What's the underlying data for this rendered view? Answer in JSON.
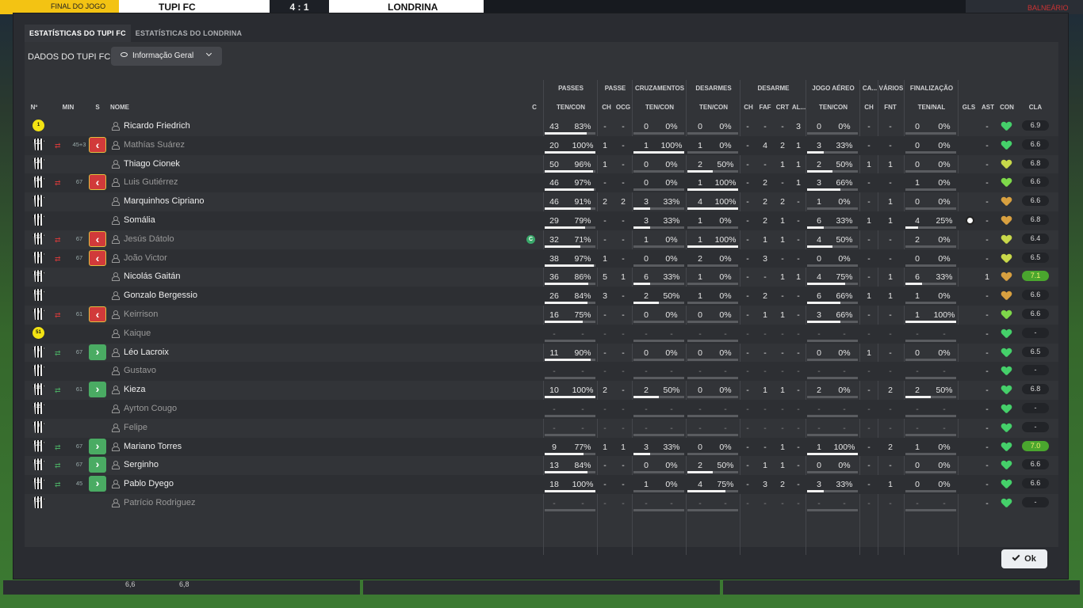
{
  "header": {
    "status": "FINAL DO JOGO",
    "home_team": "TUPI FC",
    "score": "4 : 1",
    "away_team": "LONDRINA",
    "right_label": "BALNEÁRIO"
  },
  "tabs": [
    {
      "label": "ESTATÍSTICAS DO TUPI FC",
      "active": true
    },
    {
      "label": "ESTATÍSTICAS DO LONDRINA",
      "active": false
    }
  ],
  "panel": {
    "title": "DADOS DO TUPI FC",
    "view_select": "Informação Geral"
  },
  "column_groups": [
    "PASSES",
    "PASSE",
    "CRUZAMENTOS",
    "DESARMES",
    "DESARME",
    "JOGO AÉREO",
    "CA...",
    "VÁRIOS",
    "FINALIZAÇÃO"
  ],
  "columns": {
    "num": "Nº",
    "min": "MIN",
    "s": "S",
    "name": "NOME",
    "c": "C",
    "passes": "TEN/CON",
    "ch": "CH",
    "ocg": "OCG",
    "cross": "TEN/CON",
    "tack": "TEN/CON",
    "d_ch": "CH",
    "faf": "FAF",
    "crt": "CRT",
    "al": "AL...",
    "aerial": "TEN/CON",
    "ca_ch": "CH",
    "fnt": "FNT",
    "shots": "TEN/NAL",
    "gls": "GLS",
    "ast": "AST",
    "con": "CON",
    "cla": "CLA"
  },
  "players": [
    {
      "n": "1",
      "gk": true,
      "min": "",
      "sub": "",
      "name": "Ricardo Friedrich",
      "dim": false,
      "cap": false,
      "pt": "43",
      "pc": "83%",
      "pp": 0.83,
      "ch": "-",
      "ocg": "-",
      "xt": "0",
      "xp": "0%",
      "xpp": 0,
      "dt": "0",
      "dp": "0%",
      "dpp": 0,
      "dch": "-",
      "faf": "-",
      "crt": "-",
      "al": "3",
      "at": "0",
      "ap": "0%",
      "app": 0,
      "cach": "-",
      "fnt": "-",
      "st": "0",
      "sp": "0%",
      "spp": 0,
      "gls": "",
      "ast": "-",
      "con": "#45d06a",
      "cla": "6.9",
      "best": false
    },
    {
      "n": "22",
      "gk": false,
      "min": "45+3",
      "sub": "out",
      "name": "Mathías Suárez",
      "dim": true,
      "cap": false,
      "pt": "20",
      "pc": "100%",
      "pp": 1,
      "ch": "1",
      "ocg": "-",
      "xt": "1",
      "xp": "100%",
      "xpp": 1,
      "dt": "1",
      "dp": "0%",
      "dpp": 0,
      "dch": "-",
      "faf": "4",
      "crt": "2",
      "al": "1",
      "at": "3",
      "ap": "33%",
      "app": 0.33,
      "cach": "-",
      "fnt": "-",
      "st": "0",
      "sp": "0%",
      "spp": 0,
      "gls": "",
      "ast": "-",
      "con": "#45d06a",
      "cla": "6.6",
      "best": false
    },
    {
      "n": "26",
      "gk": false,
      "min": "",
      "sub": "",
      "name": "Thiago Cionek",
      "dim": false,
      "cap": false,
      "pt": "50",
      "pc": "96%",
      "pp": 0.96,
      "ch": "1",
      "ocg": "-",
      "xt": "0",
      "xp": "0%",
      "xpp": 0,
      "dt": "2",
      "dp": "50%",
      "dpp": 0.5,
      "dch": "-",
      "faf": "-",
      "crt": "1",
      "al": "1",
      "at": "2",
      "ap": "50%",
      "app": 0.5,
      "cach": "1",
      "fnt": "1",
      "st": "0",
      "sp": "0%",
      "spp": 0,
      "gls": "",
      "ast": "-",
      "con": "#c8d84a",
      "cla": "6.8",
      "best": false
    },
    {
      "n": "14",
      "gk": false,
      "min": "67",
      "sub": "out",
      "name": "Luis Gutiérrez",
      "dim": true,
      "cap": false,
      "pt": "46",
      "pc": "97%",
      "pp": 0.97,
      "ch": "-",
      "ocg": "-",
      "xt": "0",
      "xp": "0%",
      "xpp": 0,
      "dt": "1",
      "dp": "100%",
      "dpp": 1,
      "dch": "-",
      "faf": "2",
      "crt": "-",
      "al": "1",
      "at": "3",
      "ap": "66%",
      "app": 0.66,
      "cach": "-",
      "fnt": "-",
      "st": "1",
      "sp": "0%",
      "spp": 0,
      "gls": "",
      "ast": "-",
      "con": "#7ed84a",
      "cla": "6.6",
      "best": false
    },
    {
      "n": "6",
      "gk": false,
      "min": "",
      "sub": "",
      "name": "Marquinhos Cipriano",
      "dim": false,
      "cap": false,
      "pt": "46",
      "pc": "91%",
      "pp": 0.91,
      "ch": "2",
      "ocg": "2",
      "xt": "3",
      "xp": "33%",
      "xpp": 0.33,
      "dt": "4",
      "dp": "100%",
      "dpp": 1,
      "dch": "-",
      "faf": "2",
      "crt": "2",
      "al": "-",
      "at": "1",
      "ap": "0%",
      "app": 0,
      "cach": "-",
      "fnt": "1",
      "st": "0",
      "sp": "0%",
      "spp": 0,
      "gls": "",
      "ast": "-",
      "con": "#d8a040",
      "cla": "6.6",
      "best": false
    },
    {
      "n": "2",
      "gk": false,
      "min": "",
      "sub": "",
      "name": "Somália",
      "dim": false,
      "cap": false,
      "pt": "29",
      "pc": "79%",
      "pp": 0.79,
      "ch": "-",
      "ocg": "-",
      "xt": "3",
      "xp": "33%",
      "xpp": 0.33,
      "dt": "1",
      "dp": "0%",
      "dpp": 0,
      "dch": "-",
      "faf": "2",
      "crt": "1",
      "al": "-",
      "at": "6",
      "ap": "33%",
      "app": 0.33,
      "cach": "1",
      "fnt": "1",
      "st": "4",
      "sp": "25%",
      "spp": 0.25,
      "gls": "ball",
      "ast": "-",
      "con": "#d8a040",
      "cla": "6.8",
      "best": false
    },
    {
      "n": "12",
      "gk": false,
      "min": "67",
      "sub": "out",
      "name": "Jesús Dátolo",
      "dim": true,
      "cap": true,
      "pt": "32",
      "pc": "71%",
      "pp": 0.71,
      "ch": "-",
      "ocg": "-",
      "xt": "1",
      "xp": "0%",
      "xpp": 0,
      "dt": "1",
      "dp": "100%",
      "dpp": 1,
      "dch": "-",
      "faf": "1",
      "crt": "1",
      "al": "-",
      "at": "4",
      "ap": "50%",
      "app": 0.5,
      "cach": "-",
      "fnt": "-",
      "st": "2",
      "sp": "0%",
      "spp": 0,
      "gls": "",
      "ast": "-",
      "con": "#c8d84a",
      "cla": "6.4",
      "best": false
    },
    {
      "n": "3",
      "gk": false,
      "min": "67",
      "sub": "out",
      "name": "João Victor",
      "dim": true,
      "cap": false,
      "pt": "38",
      "pc": "97%",
      "pp": 0.97,
      "ch": "1",
      "ocg": "-",
      "xt": "0",
      "xp": "0%",
      "xpp": 0,
      "dt": "2",
      "dp": "0%",
      "dpp": 0,
      "dch": "-",
      "faf": "3",
      "crt": "-",
      "al": "-",
      "at": "0",
      "ap": "0%",
      "app": 0,
      "cach": "-",
      "fnt": "-",
      "st": "0",
      "sp": "0%",
      "spp": 0,
      "gls": "",
      "ast": "-",
      "con": "#c8d84a",
      "cla": "6.5",
      "best": false
    },
    {
      "n": "15",
      "gk": false,
      "min": "",
      "sub": "",
      "name": "Nicolás Gaitán",
      "dim": false,
      "cap": false,
      "pt": "36",
      "pc": "86%",
      "pp": 0.86,
      "ch": "5",
      "ocg": "1",
      "xt": "6",
      "xp": "33%",
      "xpp": 0.33,
      "dt": "1",
      "dp": "0%",
      "dpp": 0,
      "dch": "-",
      "faf": "-",
      "crt": "1",
      "al": "1",
      "at": "4",
      "ap": "75%",
      "app": 0.75,
      "cach": "-",
      "fnt": "1",
      "st": "6",
      "sp": "33%",
      "spp": 0.33,
      "gls": "",
      "ast": "1",
      "con": "#d8a040",
      "cla": "7.1",
      "best": true
    },
    {
      "n": "10",
      "gk": false,
      "min": "",
      "sub": "",
      "name": "Gonzalo Bergessio",
      "dim": false,
      "cap": false,
      "pt": "26",
      "pc": "84%",
      "pp": 0.84,
      "ch": "3",
      "ocg": "-",
      "xt": "2",
      "xp": "50%",
      "xpp": 0.5,
      "dt": "1",
      "dp": "0%",
      "dpp": 0,
      "dch": "-",
      "faf": "2",
      "crt": "-",
      "al": "-",
      "at": "6",
      "ap": "66%",
      "app": 0.66,
      "cach": "1",
      "fnt": "1",
      "st": "1",
      "sp": "0%",
      "spp": 0,
      "gls": "",
      "ast": "-",
      "con": "#d8a040",
      "cla": "6.6",
      "best": false
    },
    {
      "n": "9",
      "gk": false,
      "min": "61",
      "sub": "out",
      "name": "Keirrison",
      "dim": true,
      "cap": false,
      "pt": "16",
      "pc": "75%",
      "pp": 0.75,
      "ch": "-",
      "ocg": "-",
      "xt": "0",
      "xp": "0%",
      "xpp": 0,
      "dt": "0",
      "dp": "0%",
      "dpp": 0,
      "dch": "-",
      "faf": "1",
      "crt": "1",
      "al": "-",
      "at": "3",
      "ap": "66%",
      "app": 0.66,
      "cach": "-",
      "fnt": "-",
      "st": "1",
      "sp": "100%",
      "spp": 1,
      "gls": "",
      "ast": "-",
      "con": "#7ed84a",
      "cla": "6.6",
      "best": false
    },
    {
      "n": "51",
      "gk": true,
      "min": "",
      "sub": "",
      "name": "Kaique",
      "dim": true,
      "cap": false,
      "pt": "-",
      "pc": "-",
      "pp": 0,
      "ch": "-",
      "ocg": "-",
      "xt": "-",
      "xp": "-",
      "xpp": 0,
      "dt": "-",
      "dp": "-",
      "dpp": 0,
      "dch": "-",
      "faf": "-",
      "crt": "-",
      "al": "-",
      "at": "-",
      "ap": "-",
      "app": 0,
      "cach": "-",
      "fnt": "-",
      "st": "-",
      "sp": "-",
      "spp": 0,
      "gls": "",
      "ast": "-",
      "con": "#45d06a",
      "cla": "-",
      "best": false
    },
    {
      "n": "4",
      "gk": false,
      "min": "67",
      "sub": "in",
      "name": "Léo Lacroix",
      "dim": false,
      "cap": false,
      "pt": "11",
      "pc": "90%",
      "pp": 0.9,
      "ch": "-",
      "ocg": "-",
      "xt": "0",
      "xp": "0%",
      "xpp": 0,
      "dt": "0",
      "dp": "0%",
      "dpp": 0,
      "dch": "-",
      "faf": "-",
      "crt": "-",
      "al": "-",
      "at": "0",
      "ap": "0%",
      "app": 0,
      "cach": "1",
      "fnt": "-",
      "st": "0",
      "sp": "0%",
      "spp": 0,
      "gls": "",
      "ast": "-",
      "con": "#45d06a",
      "cla": "6.5",
      "best": false
    },
    {
      "n": "7",
      "gk": false,
      "min": "",
      "sub": "",
      "name": "Gustavo",
      "dim": true,
      "cap": false,
      "pt": "-",
      "pc": "-",
      "pp": 0,
      "ch": "-",
      "ocg": "-",
      "xt": "-",
      "xp": "-",
      "xpp": 0,
      "dt": "-",
      "dp": "-",
      "dpp": 0,
      "dch": "-",
      "faf": "-",
      "crt": "-",
      "al": "-",
      "at": "-",
      "ap": "-",
      "app": 0,
      "cach": "-",
      "fnt": "-",
      "st": "-",
      "sp": "-",
      "spp": 0,
      "gls": "",
      "ast": "-",
      "con": "#45d06a",
      "cla": "-",
      "best": false
    },
    {
      "n": "18",
      "gk": false,
      "min": "61",
      "sub": "in",
      "name": "Kieza",
      "dim": false,
      "cap": false,
      "pt": "10",
      "pc": "100%",
      "pp": 1,
      "ch": "2",
      "ocg": "-",
      "xt": "2",
      "xp": "50%",
      "xpp": 0.5,
      "dt": "0",
      "dp": "0%",
      "dpp": 0,
      "dch": "-",
      "faf": "1",
      "crt": "1",
      "al": "-",
      "at": "2",
      "ap": "0%",
      "app": 0,
      "cach": "-",
      "fnt": "2",
      "st": "2",
      "sp": "50%",
      "spp": 0.5,
      "gls": "",
      "ast": "-",
      "con": "#45d06a",
      "cla": "6.8",
      "best": false
    },
    {
      "n": "15",
      "gk": false,
      "min": "",
      "sub": "",
      "name": "Ayrton Cougo",
      "dim": true,
      "cap": false,
      "pt": "-",
      "pc": "-",
      "pp": 0,
      "ch": "-",
      "ocg": "-",
      "xt": "-",
      "xp": "-",
      "xpp": 0,
      "dt": "-",
      "dp": "-",
      "dpp": 0,
      "dch": "-",
      "faf": "-",
      "crt": "-",
      "al": "-",
      "at": "-",
      "ap": "-",
      "app": 0,
      "cach": "-",
      "fnt": "-",
      "st": "-",
      "sp": "-",
      "spp": 0,
      "gls": "",
      "ast": "-",
      "con": "#45d06a",
      "cla": "-",
      "best": false
    },
    {
      "n": "8",
      "gk": false,
      "min": "",
      "sub": "",
      "name": "Felipe",
      "dim": true,
      "cap": false,
      "pt": "-",
      "pc": "-",
      "pp": 0,
      "ch": "-",
      "ocg": "-",
      "xt": "-",
      "xp": "-",
      "xpp": 0,
      "dt": "-",
      "dp": "-",
      "dpp": 0,
      "dch": "-",
      "faf": "-",
      "crt": "-",
      "al": "-",
      "at": "-",
      "ap": "-",
      "app": 0,
      "cach": "-",
      "fnt": "-",
      "st": "-",
      "sp": "-",
      "spp": 0,
      "gls": "",
      "ast": "-",
      "con": "#45d06a",
      "cla": "-",
      "best": false
    },
    {
      "n": "20",
      "gk": false,
      "min": "67",
      "sub": "in",
      "name": "Mariano Torres",
      "dim": false,
      "cap": false,
      "pt": "9",
      "pc": "77%",
      "pp": 0.77,
      "ch": "1",
      "ocg": "1",
      "xt": "3",
      "xp": "33%",
      "xpp": 0.33,
      "dt": "0",
      "dp": "0%",
      "dpp": 0,
      "dch": "-",
      "faf": "-",
      "crt": "1",
      "al": "-",
      "at": "1",
      "ap": "100%",
      "app": 1,
      "cach": "-",
      "fnt": "2",
      "st": "1",
      "sp": "0%",
      "spp": 0,
      "gls": "",
      "ast": "-",
      "con": "#45d06a",
      "cla": "7.0",
      "best": true
    },
    {
      "n": "16",
      "gk": false,
      "min": "67",
      "sub": "in",
      "name": "Serginho",
      "dim": false,
      "cap": false,
      "pt": "13",
      "pc": "84%",
      "pp": 0.84,
      "ch": "-",
      "ocg": "-",
      "xt": "0",
      "xp": "0%",
      "xpp": 0,
      "dt": "2",
      "dp": "50%",
      "dpp": 0.5,
      "dch": "-",
      "faf": "1",
      "crt": "1",
      "al": "-",
      "at": "0",
      "ap": "0%",
      "app": 0,
      "cach": "-",
      "fnt": "-",
      "st": "0",
      "sp": "0%",
      "spp": 0,
      "gls": "",
      "ast": "-",
      "con": "#45d06a",
      "cla": "6.6",
      "best": false
    },
    {
      "n": "11",
      "gk": false,
      "min": "45",
      "sub": "in",
      "name": "Pablo Dyego",
      "dim": false,
      "cap": false,
      "pt": "18",
      "pc": "100%",
      "pp": 1,
      "ch": "-",
      "ocg": "-",
      "xt": "1",
      "xp": "0%",
      "xpp": 0,
      "dt": "4",
      "dp": "75%",
      "dpp": 0.75,
      "dch": "-",
      "faf": "3",
      "crt": "2",
      "al": "-",
      "at": "3",
      "ap": "33%",
      "app": 0.33,
      "cach": "-",
      "fnt": "1",
      "st": "0",
      "sp": "0%",
      "spp": 0,
      "gls": "",
      "ast": "-",
      "con": "#45d06a",
      "cla": "6.6",
      "best": false
    },
    {
      "n": "17",
      "gk": false,
      "min": "",
      "sub": "",
      "name": "Patrício Rodriguez",
      "dim": true,
      "cap": false,
      "pt": "-",
      "pc": "-",
      "pp": 0,
      "ch": "-",
      "ocg": "-",
      "xt": "-",
      "xp": "-",
      "xpp": 0,
      "dt": "-",
      "dp": "-",
      "dpp": 0,
      "dch": "-",
      "faf": "-",
      "crt": "-",
      "al": "-",
      "at": "-",
      "ap": "-",
      "app": 0,
      "cach": "-",
      "fnt": "-",
      "st": "-",
      "sp": "-",
      "spp": 0,
      "gls": "",
      "ast": "-",
      "con": "#45d06a",
      "cla": "-",
      "best": false
    }
  ],
  "captain_badge": "C",
  "ok_button": "Ok",
  "bottom": {
    "left_val": "6,6",
    "right_val": "6,8"
  }
}
